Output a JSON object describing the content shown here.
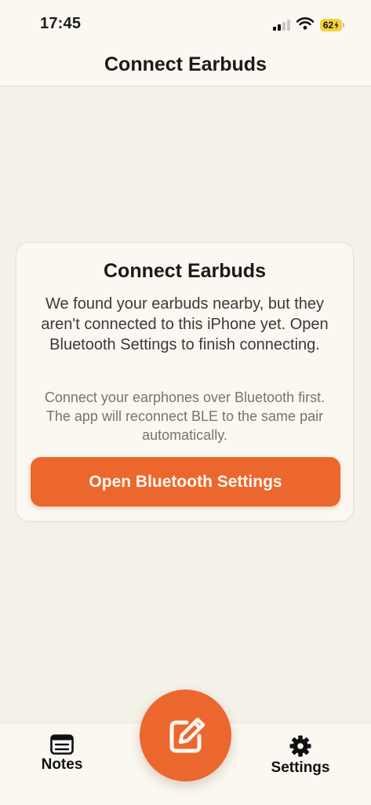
{
  "status_bar": {
    "time": "17:45",
    "battery_level": "62"
  },
  "header": {
    "title": "Connect Earbuds"
  },
  "card": {
    "title": "Connect Earbuds",
    "body": "We found your earbuds nearby, but they aren't connected to this iPhone yet. Open Bluetooth Settings to finish connecting.",
    "note": "Connect your earphones over Bluetooth first. The app will reconnect BLE to the same pair automatically.",
    "button_label": "Open Bluetooth Settings"
  },
  "tabbar": {
    "tabs": [
      {
        "label": "Notes",
        "icon": "notes-icon"
      },
      {
        "label": "Settings",
        "icon": "gear-icon"
      }
    ],
    "fab_icon": "compose-icon"
  },
  "colors": {
    "accent": "#ec672e",
    "background": "#f4f1e9",
    "surface": "#faf8f1",
    "battery": "#f1d23a"
  }
}
